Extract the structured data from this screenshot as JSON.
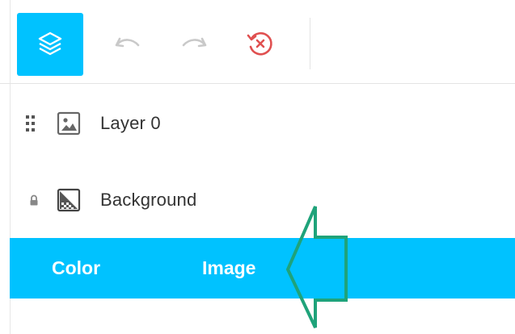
{
  "toolbar": {
    "layers_icon": "layers-icon",
    "undo_icon": "undo-icon",
    "redo_icon": "redo-icon",
    "reset_icon": "reset-icon",
    "accent_color": "#00c2ff",
    "reset_color": "#e05050"
  },
  "layers": [
    {
      "label": "Layer 0",
      "icon": "image-icon",
      "control": "drag-handle-icon"
    },
    {
      "label": "Background",
      "icon": "background-icon",
      "control": "lock-icon"
    }
  ],
  "tabs": [
    {
      "label": "Color"
    },
    {
      "label": "Image"
    }
  ],
  "annotation": {
    "icon": "arrow-annotation",
    "color": "#1fa37a"
  }
}
